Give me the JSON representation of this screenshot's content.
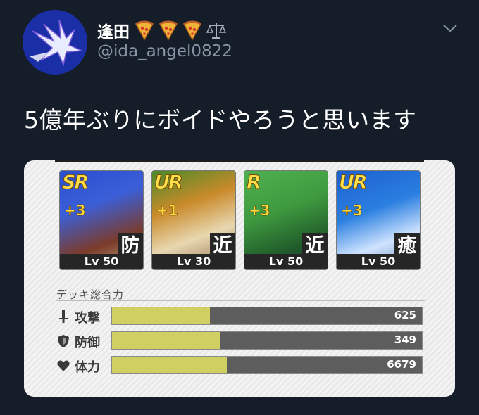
{
  "user": {
    "display_name": "逢田",
    "handle": "@ida_angel0822",
    "emojis": [
      "pizza-emoji",
      "pizza-emoji",
      "pizza-emoji",
      "balance-scale-emoji"
    ]
  },
  "tweet": {
    "text": "5億年ぶりにボイドやろうと思います"
  },
  "media": {
    "cards": [
      {
        "rarity": "SR",
        "plus": "+3",
        "role": "防",
        "level": "Lv 50",
        "colors": [
          "#2a4fcf",
          "#7b3b2a"
        ]
      },
      {
        "rarity": "UR",
        "plus": "+1",
        "role": "近",
        "level": "Lv 30",
        "colors": [
          "#c98a2a",
          "#e8d7b0"
        ]
      },
      {
        "rarity": "R",
        "plus": "+3",
        "role": "近",
        "level": "Lv 50",
        "colors": [
          "#3f9a3f",
          "#1f5a2a"
        ]
      },
      {
        "rarity": "UR",
        "plus": "+3",
        "role": "癒",
        "level": "Lv 50",
        "colors": [
          "#2a7fe0",
          "#cfe3ff"
        ]
      }
    ],
    "section_title": "デッキ総合力",
    "stats": [
      {
        "icon": "sword-icon",
        "label": "攻撃",
        "value": "625",
        "fill_fraction": 0.315
      },
      {
        "icon": "shield-icon",
        "label": "防御",
        "value": "349",
        "fill_fraction": 0.35
      },
      {
        "icon": "heart-icon",
        "label": "体力",
        "value": "6679",
        "fill_fraction": 0.37
      }
    ]
  }
}
